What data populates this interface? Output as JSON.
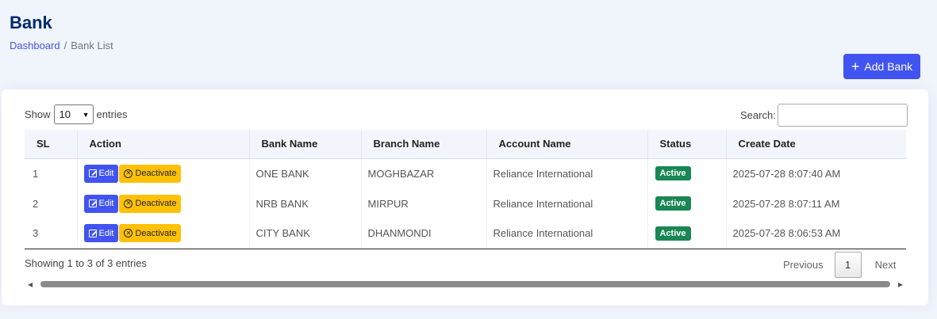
{
  "header": {
    "title": "Bank",
    "breadcrumb": {
      "home": "Dashboard",
      "separator": "/",
      "current": "Bank List"
    },
    "add_button_label": "Add Bank"
  },
  "table_controls": {
    "show_label": "Show",
    "entries_value": "10",
    "entries_label": "entries",
    "search_label": "Search:",
    "search_value": ""
  },
  "table": {
    "columns": [
      "SL",
      "Action",
      "Bank Name",
      "Branch Name",
      "Account Name",
      "Status",
      "Create Date"
    ],
    "edit_label": "Edit",
    "deactivate_label": "Deactivate",
    "rows": [
      {
        "sl": "1",
        "bank_name": "ONE BANK",
        "branch_name": "MOGHBAZAR",
        "account_name": "Reliance International",
        "status": "Active",
        "create_date": "2025-07-28 8:07:40 AM"
      },
      {
        "sl": "2",
        "bank_name": "NRB BANK",
        "branch_name": "MIRPUR",
        "account_name": "Reliance International",
        "status": "Active",
        "create_date": "2025-07-28 8:07:11 AM"
      },
      {
        "sl": "3",
        "bank_name": "CITY BANK",
        "branch_name": "DHANMONDI",
        "account_name": "Reliance International",
        "status": "Active",
        "create_date": "2025-07-28 8:06:53 AM"
      }
    ]
  },
  "footer": {
    "info": "Showing 1 to 3 of 3 entries",
    "prev_label": "Previous",
    "current_page": "1",
    "next_label": "Next"
  },
  "icons": {
    "add": "plus-icon",
    "edit": "edit-icon",
    "deactivate": "x-circle-icon",
    "select": "chevron-down-icon"
  },
  "colors": {
    "primary": "#4154f1",
    "warning": "#ffc107",
    "success": "#198754",
    "title": "#012970",
    "background": "#f0f4fb"
  }
}
